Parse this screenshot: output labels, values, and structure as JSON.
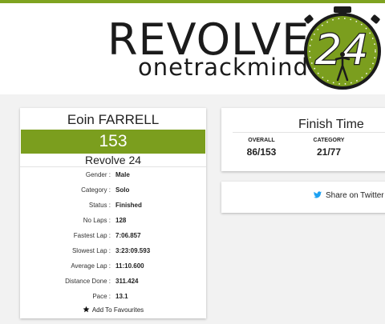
{
  "brand": {
    "name": "REVOLVE",
    "tagline": "onetrackmind",
    "badge_number": "24",
    "accent_color": "#7b9e1e"
  },
  "rider": {
    "name": "Eoin FARRELL",
    "number": "153",
    "event": "Revolve 24",
    "details": [
      {
        "label": "Gender :",
        "value": "Male"
      },
      {
        "label": "Category :",
        "value": "Solo"
      },
      {
        "label": "Status :",
        "value": "Finished"
      },
      {
        "label": "No Laps :",
        "value": "128"
      },
      {
        "label": "Fastest Lap :",
        "value": "7:06.857"
      },
      {
        "label": "Slowest Lap :",
        "value": "3:23:09.593"
      },
      {
        "label": "Average Lap :",
        "value": "11:10.600"
      },
      {
        "label": "Distance Done :",
        "value": "311.424"
      },
      {
        "label": "Pace :",
        "value": "13.1"
      }
    ],
    "favourite_label": "Add To Favourites"
  },
  "finish": {
    "title": "Finish Time",
    "overall_label": "OVERALL",
    "overall_value": "86/153",
    "category_label": "CATEGORY",
    "category_value": "21/77"
  },
  "share": {
    "label": "Share on Twitter",
    "icon": "twitter-icon"
  }
}
